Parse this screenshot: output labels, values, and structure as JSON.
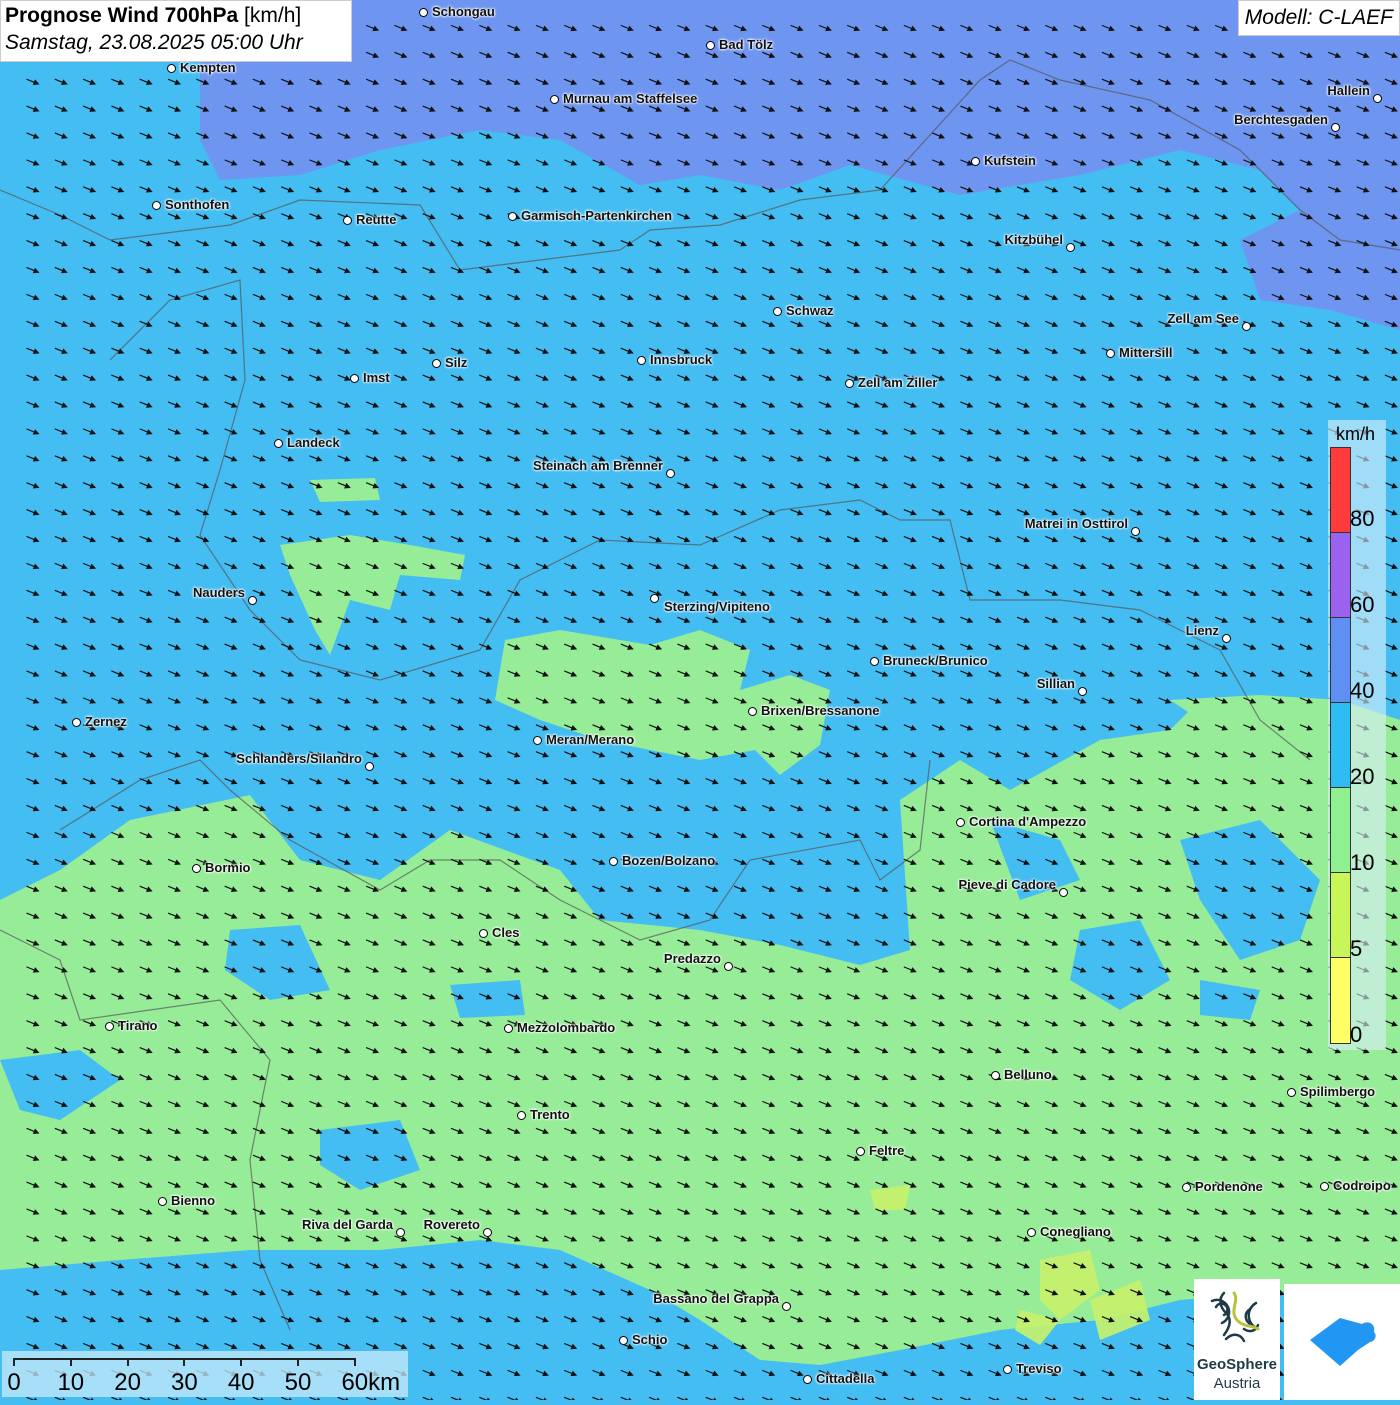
{
  "header": {
    "title": "Prognose Wind 700hPa",
    "unit": "[km/h]",
    "datetime": "Samstag, 23.08.2025 05:00 Uhr",
    "model": "Modell: C-LAEF"
  },
  "colors": {
    "base": "#44bdf2",
    "band_40_60": "#7390ef",
    "band_10_20": "#97ec98",
    "band_5_10": "#c8f26a",
    "arrow": "#111111"
  },
  "legend": {
    "unit": "km/h",
    "labels": [
      "80",
      "60",
      "40",
      "20",
      "10",
      "5",
      "0"
    ],
    "colors": [
      "#ff3b3b",
      "#9a62ef",
      "#5f8ff3",
      "#2ebdf2",
      "#8ef08e",
      "#c8f558",
      "#ffff66"
    ]
  },
  "scale": {
    "labels": [
      "0",
      "10",
      "20",
      "30",
      "40",
      "50",
      "60km"
    ]
  },
  "cities": [
    "Schongau",
    "Bad Tölz",
    "Kempten",
    "Murnau am Staffelsee",
    "Hallein",
    "Berchtesgaden",
    "Kufstein",
    "Sonthofen",
    "Reutte",
    "Garmisch-Partenkirchen",
    "Kitzbühel",
    "Schwaz",
    "Zell am See",
    "Mittersill",
    "Silz",
    "Innsbruck",
    "Imst",
    "Zell am Ziller",
    "Landeck",
    "Steinach am Brenner",
    "Matrei in Osttirol",
    "Nauders",
    "Sterzing/Vipiteno",
    "Lienz",
    "Bruneck/Brunico",
    "Sillian",
    "Brixen/Bressanone",
    "Zernez",
    "Meran/Merano",
    "Schlanders/Silandro",
    "Cortina d'Ampezzo",
    "Bozen/Bolzano",
    "Bormio",
    "Pieve di Cadore",
    "Cles",
    "Predazzo",
    "Tirano",
    "Mezzolombardo",
    "Belluno",
    "Spilimbergo",
    "Trento",
    "Feltre",
    "Pordenone",
    "Codroipo",
    "Bienno",
    "Riva del Garda",
    "Rovereto",
    "Conegliano",
    "Bassano del Grappa",
    "Schio",
    "Treviso",
    "Cittadella"
  ],
  "logos": {
    "geosphere_line1": "GeoSphere",
    "geosphere_line2": "Austria"
  }
}
